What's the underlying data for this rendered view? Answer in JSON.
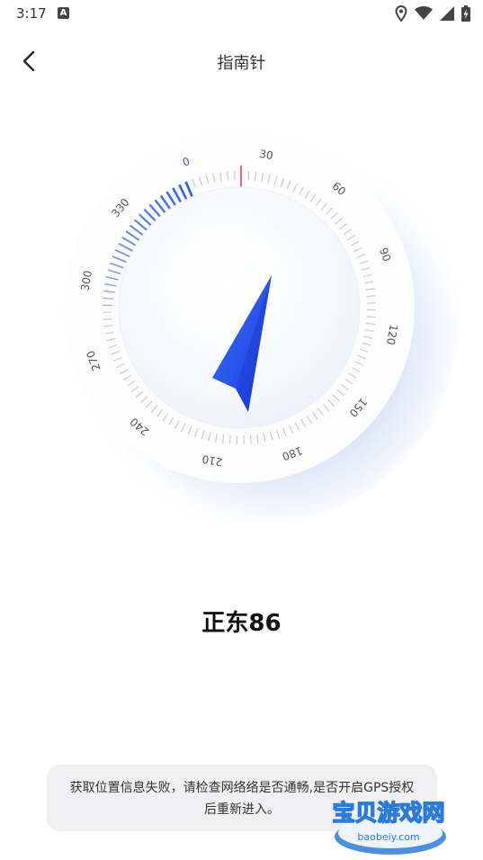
{
  "status_bar": {
    "time": "3:17",
    "notification_letter": "A"
  },
  "header": {
    "title": "指南针"
  },
  "compass": {
    "labels": [
      "0",
      "30",
      "60",
      "90",
      "120",
      "150",
      "180",
      "210",
      "240",
      "270",
      "300",
      "330"
    ],
    "heading_degrees": 86,
    "accent_color": "#2f5cf2",
    "north_marker_color": "#f06292"
  },
  "readout": {
    "direction": "正东86"
  },
  "toast": {
    "message": "获取位置信息失败，请检查网络络是否通畅,是否开启GPS授权后重新进入。"
  },
  "watermark": {
    "title": "宝贝游戏网",
    "url": "baobeiy.com"
  }
}
